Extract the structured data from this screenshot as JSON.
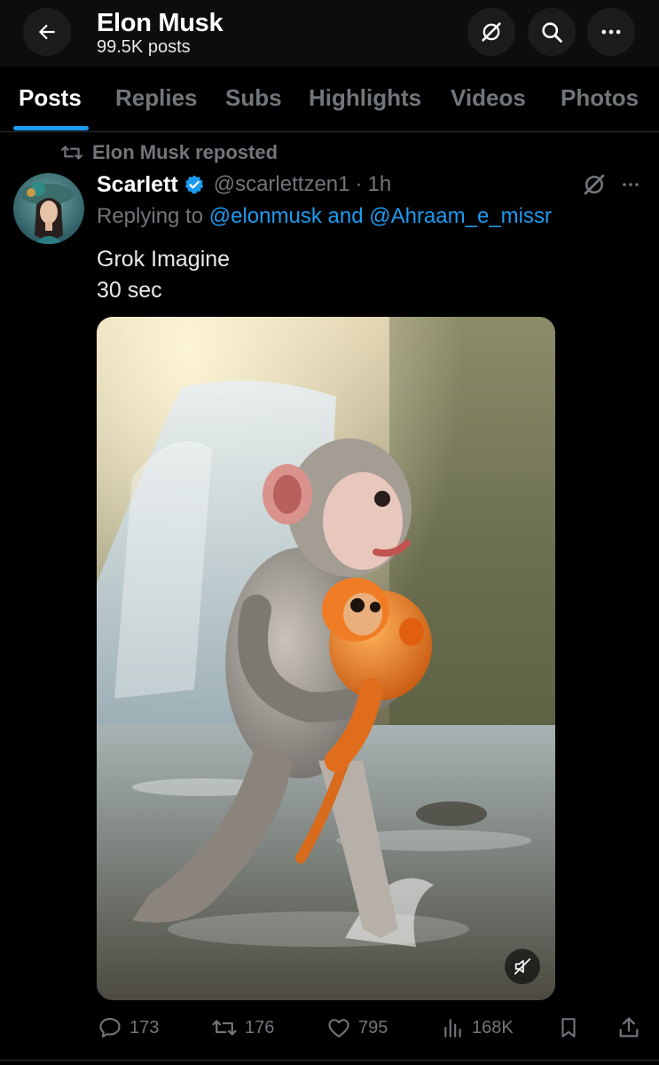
{
  "header": {
    "title": "Elon Musk",
    "post_count": "99.5K posts"
  },
  "tabs": [
    {
      "label": "Posts",
      "active": true
    },
    {
      "label": "Replies",
      "active": false
    },
    {
      "label": "Subs",
      "active": false
    },
    {
      "label": "Highlights",
      "active": false
    },
    {
      "label": "Videos",
      "active": false
    },
    {
      "label": "Photos",
      "active": false
    }
  ],
  "post": {
    "repost_label": "Elon Musk reposted",
    "author": {
      "name": "Scarlett",
      "verified": true,
      "handle": "@scarlettzen1",
      "separator": "·",
      "time": "1h"
    },
    "reply_prefix": "Replying to",
    "reply_mentions": [
      "@elonmusk",
      "and",
      "@Ahraam_e_missr"
    ],
    "text_lines": [
      "Grok Imagine",
      "30 sec"
    ],
    "media": {
      "type": "video",
      "muted": true
    },
    "stats": {
      "replies": "173",
      "reposts": "176",
      "likes": "795",
      "views": "168K"
    }
  },
  "colors": {
    "background": "#000000",
    "header_bg": "#0d0d0d",
    "accent": "#1d9bf0",
    "muted_text": "#71767b",
    "verified_badge": "#1d9bf0"
  },
  "icons": {
    "back": "arrow-left-icon",
    "grok": "grok-icon",
    "search": "search-icon",
    "more": "more-horizontal-icon",
    "repost": "repost-icon",
    "verified": "verified-badge-icon",
    "reply": "reply-icon",
    "like": "heart-icon",
    "views": "views-icon",
    "bookmark": "bookmark-icon",
    "share": "share-icon",
    "mute": "volume-muted-icon"
  }
}
